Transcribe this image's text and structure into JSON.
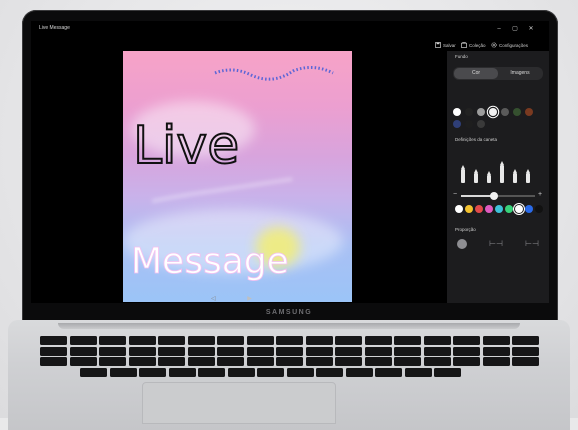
{
  "window": {
    "title": "Live Message"
  },
  "device": {
    "brand": "SAMSUNG"
  },
  "window_controls": [
    "–",
    "▢",
    "✕"
  ],
  "toolbar": {
    "save_label": "Salvar",
    "collection_label": "Coleção",
    "settings_label": "Configurações"
  },
  "panel": {
    "background_title": "Fundo",
    "tabs": [
      {
        "label": "Cor",
        "active": true
      },
      {
        "label": "Imagens",
        "active": false
      }
    ],
    "background_colors": [
      "#ffffff",
      "#222222",
      "#9c9c9c",
      "#f2f2f2",
      "#5a5a5a",
      "#35502f",
      "#7a3a20",
      "#2f3f78",
      "#1e1e1e",
      "#3a3a3a"
    ],
    "pen_title": "Definições da caneta",
    "pen_colors": [
      "#ffffff",
      "#f2c12e",
      "#e24a4a",
      "#e05ac0",
      "#3ec1d8",
      "#38d27a",
      "#ffffff",
      "#2a6ae8",
      "#111111"
    ],
    "pen_size_slider": 0.45,
    "proportion_title": "Proporção"
  },
  "canvas": {
    "gradient": [
      "#f7a3c7",
      "#9bc4f7"
    ],
    "text_top": "Live",
    "text_bottom": "Message"
  },
  "playbar": {
    "icon": "play-icon"
  },
  "icons": [
    "save-icon",
    "collection-icon",
    "gear-icon",
    "play-icon"
  ]
}
